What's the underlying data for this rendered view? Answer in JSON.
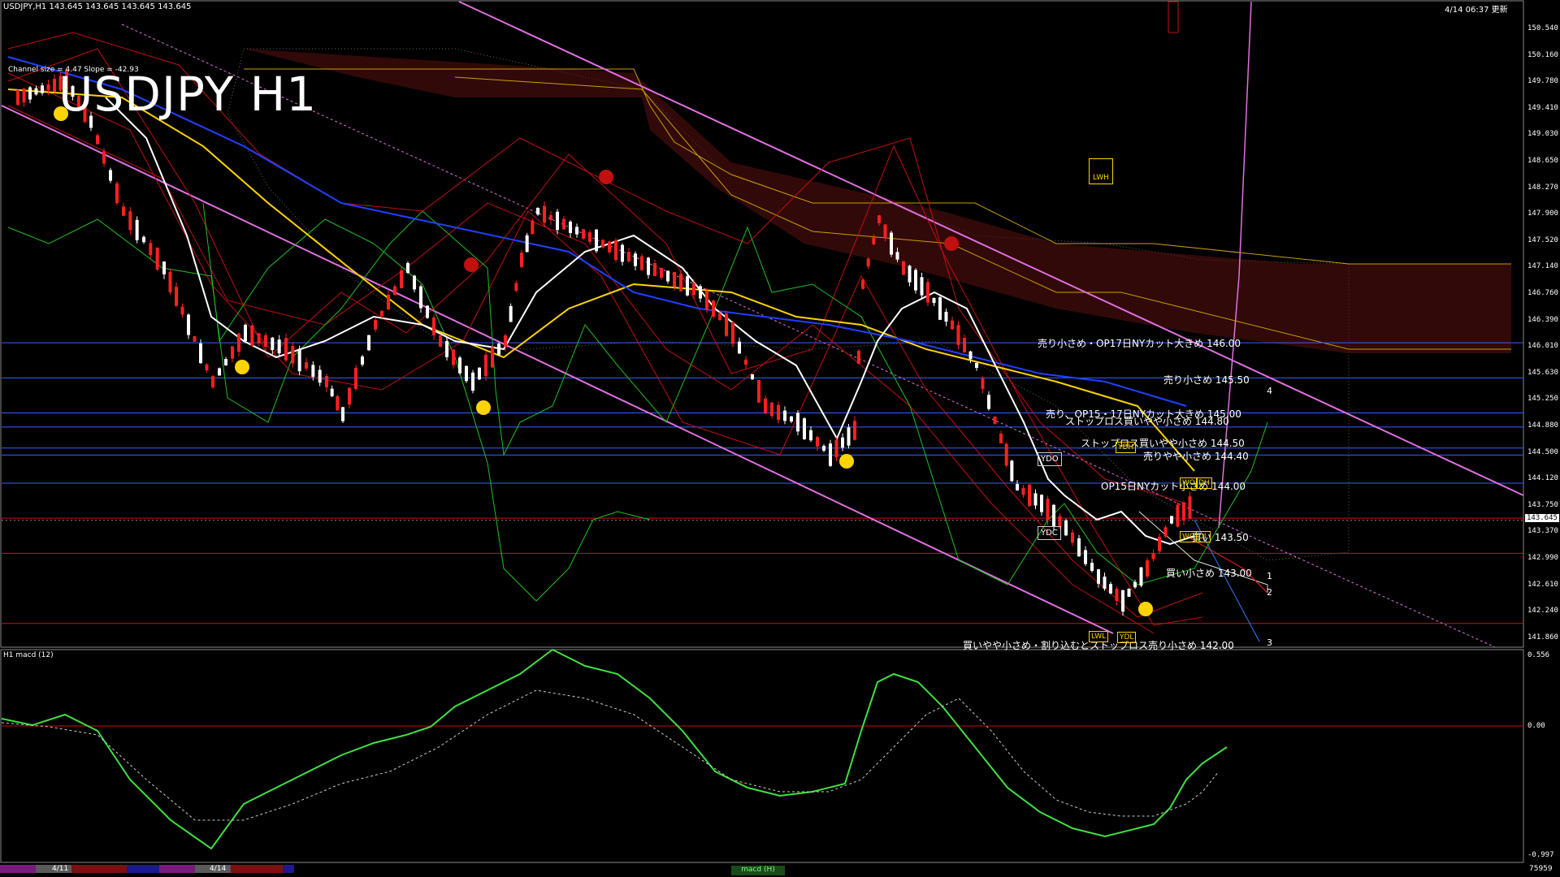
{
  "header": {
    "symbol_info": "USDJPY,H1  143.645 143.645 143.645 143.645",
    "datetime": "4/14 06:37 更新",
    "channel_info": "Channel size = 4.47 Slope = -42.93",
    "title": "USDJPY H1"
  },
  "price_axis": {
    "ticks": [
      "150.540",
      "150.160",
      "149.780",
      "149.410",
      "149.030",
      "148.650",
      "148.270",
      "147.900",
      "147.520",
      "147.140",
      "146.760",
      "146.390",
      "146.010",
      "145.630",
      "145.250",
      "144.880",
      "144.500",
      "144.120",
      "143.750",
      "143.370",
      "142.990",
      "142.610",
      "142.240",
      "141.860"
    ],
    "current_price": "143.645"
  },
  "levels": [
    {
      "text": "売り小さめ・OP17日NYカット大きめ 146.00"
    },
    {
      "text": "売り小さめ 145.50"
    },
    {
      "text": "売り、OP15・17日NYカット大きめ 145.00"
    },
    {
      "text": "ストップロス買いやや小さめ 144.80"
    },
    {
      "text": "ストップロス買いやや小さめ 144.50"
    },
    {
      "text": "売りやや小さめ 144.40"
    },
    {
      "text": "OP15日NYカット小さめ 144.00"
    },
    {
      "text": "買い 143.50"
    },
    {
      "text": "買い小さめ 143.00"
    },
    {
      "text": "買いやや小さめ・割り込むとストップロス売り小さめ 142.00"
    }
  ],
  "boxes": {
    "ydo": "YDO",
    "ydc": "YDC",
    "ydh": "YDH",
    "ydl": "YDL",
    "lwh": "LWH",
    "lwl": "LWL",
    "wo": "WO",
    "dh": "DH",
    "wc": "WC",
    "dl": "DL"
  },
  "trend_numbers": [
    "4",
    "1",
    "2",
    "3"
  ],
  "macd": {
    "label": "H1  macd (12)",
    "ticks": [
      "0.556",
      "0.00",
      "-0.997"
    ],
    "tab": "macd (H)"
  },
  "bottom": {
    "dates": [
      "4/11",
      "4/14"
    ],
    "counter": "75959"
  },
  "colors": {
    "background": "#000000",
    "bull_candle": "#ffffff",
    "bear_candle": "#ff2020",
    "ma_fast": "#ffffff",
    "ma_mid": "#ffd400",
    "ma_slow": "#2040ff",
    "bollinger": "#c01010",
    "chikou": "#20c020",
    "channel": "#e070e0",
    "level_blue": "#3060ff",
    "level_red": "#d01010",
    "macd_line": "#40e040",
    "macd_line_down": "#ff80a0"
  }
}
